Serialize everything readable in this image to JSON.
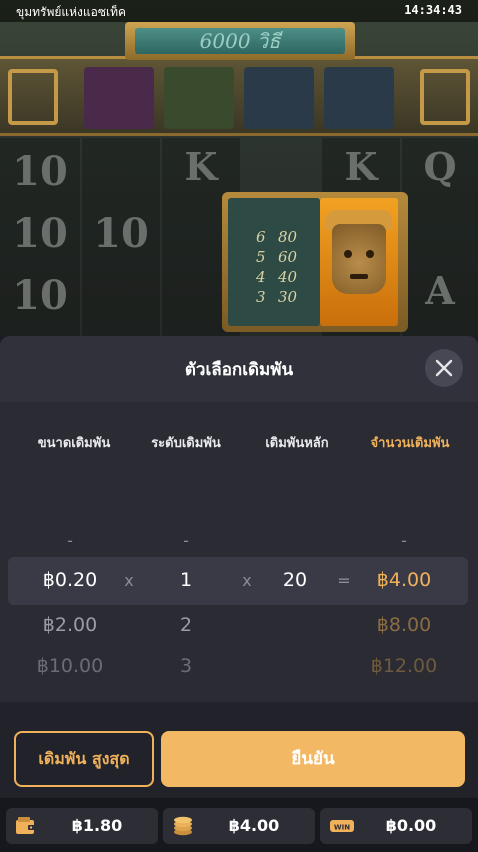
{
  "status_bar": {
    "game_title": "ขุมทรัพย์แห่งแอซเท็ค",
    "time": "14:34:43"
  },
  "game": {
    "ways_banner": "6000 วิธี",
    "paytable": [
      {
        "count": "6",
        "payout": "80"
      },
      {
        "count": "5",
        "payout": "60"
      },
      {
        "count": "4",
        "payout": "40"
      },
      {
        "count": "3",
        "payout": "30"
      }
    ]
  },
  "bet_sheet": {
    "title": "ตัวเลือกเดิมพัน",
    "columns": {
      "bet_size": "ขนาดเดิมพัน",
      "bet_level": "ระดับเดิมพัน",
      "base_bet": "เดิมพันหลัก",
      "total_bet": "จำนวนเดิมพัน"
    },
    "placeholder": "-",
    "operators": {
      "times": "x",
      "equals": "="
    },
    "rows": [
      {
        "bet_size": "฿0.20",
        "bet_level": "1",
        "base_bet": "20",
        "total_bet": "฿4.00"
      },
      {
        "bet_size": "฿2.00",
        "bet_level": "2",
        "base_bet": "",
        "total_bet": "฿8.00"
      },
      {
        "bet_size": "฿10.00",
        "bet_level": "3",
        "base_bet": "",
        "total_bet": "฿12.00"
      }
    ],
    "max_bet_label": "เดิมพัน สูงสุด",
    "confirm_label": "ยืนยัน"
  },
  "footer": {
    "balance": "฿1.80",
    "bet": "฿4.00",
    "win": "฿0.00",
    "win_badge": "WIN",
    "accent_color": "#f0b15b"
  }
}
